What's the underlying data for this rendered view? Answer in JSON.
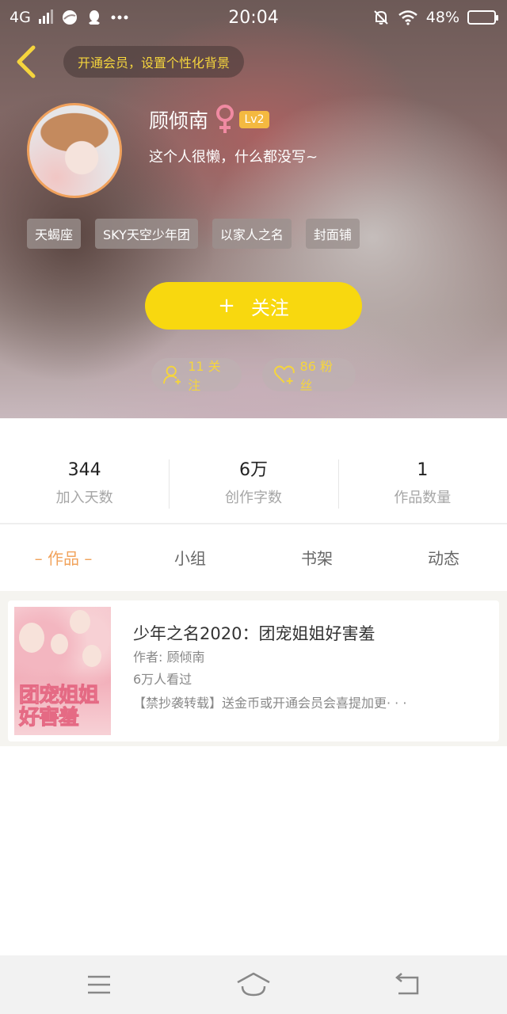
{
  "status_bar": {
    "network": "4G",
    "time": "20:04",
    "battery": "48%",
    "battery_level": 0.48,
    "icons": [
      "signal-icon",
      "browser-icon",
      "qq-icon",
      "more-icon",
      "mute-alarm-icon",
      "wifi-icon",
      "battery-icon"
    ]
  },
  "header": {
    "vip_banner": "开通会员，设置个性化背景",
    "username": "顾倾南",
    "gender": "female",
    "level": "Lv2",
    "bio": "这个人很懒，什么都没写~",
    "tags": [
      "天蝎座",
      "SKY天空少年团",
      "以家人之名",
      "封面铺"
    ],
    "follow_button": {
      "icon": "+",
      "label": "关注"
    },
    "following": "11 关注",
    "fans": "86 粉丝"
  },
  "stats": [
    {
      "value": "344",
      "label": "加入天数"
    },
    {
      "value": "6万",
      "label": "创作字数"
    },
    {
      "value": "1",
      "label": "作品数量"
    }
  ],
  "tabs": [
    {
      "label": "– 作品 –",
      "active": true
    },
    {
      "label": "小组",
      "active": false
    },
    {
      "label": "书架",
      "active": false
    },
    {
      "label": "动态",
      "active": false
    }
  ],
  "books": [
    {
      "title": "少年之名2020：团宠姐姐好害羞",
      "author": "作者: 顾倾南",
      "views": "6万人看过",
      "description": "【禁抄袭转载】送金币或开通会员会喜提加更· · ·",
      "cover_text": "团宠姐姐好害羞"
    }
  ],
  "colors": {
    "accent_yellow": "#f8d80f",
    "tab_active": "#f1a35c",
    "pill_text": "#f5d53d",
    "avatar_border": "#f0a15c"
  }
}
